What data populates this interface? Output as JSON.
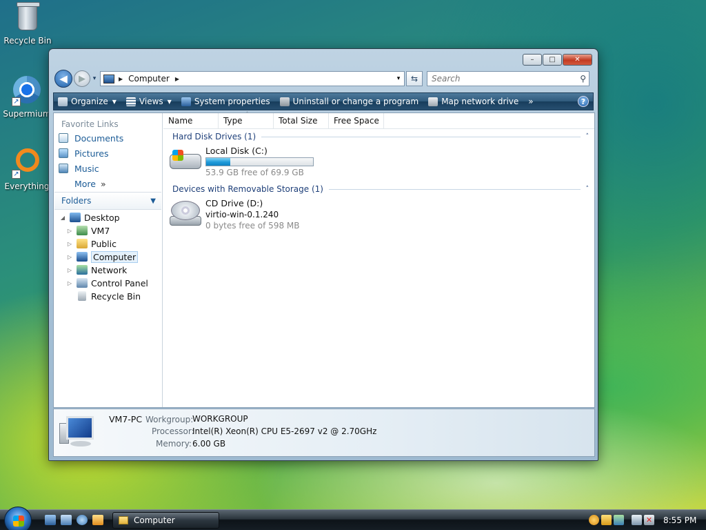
{
  "desktop": {
    "icons": [
      {
        "label": "Recycle Bin",
        "icon": "recycle-bin-icon"
      },
      {
        "label": "Supermium",
        "icon": "browser-icon"
      },
      {
        "label": "Everything",
        "icon": "everything-search-icon"
      }
    ]
  },
  "window": {
    "controls": {
      "minimize": "–",
      "maximize": "□",
      "close": "✕"
    },
    "nav": {
      "back": "◀",
      "forward": "▶",
      "history_dropdown": "▾"
    },
    "address": {
      "crumb_sep": "▶",
      "crumb": "Computer",
      "dropdown": "▾"
    },
    "refresh_label": "⇆",
    "search": {
      "placeholder": "Search",
      "icon": "search-icon"
    },
    "commands": [
      {
        "label": "Organize",
        "dropdown": true,
        "icon": "organize-icon"
      },
      {
        "label": "Views",
        "dropdown": true,
        "icon": "views-icon"
      },
      {
        "label": "System properties",
        "dropdown": false,
        "icon": "system-properties-icon"
      },
      {
        "label": "Uninstall or change a program",
        "dropdown": false,
        "icon": "uninstall-icon"
      },
      {
        "label": "Map network drive",
        "dropdown": false,
        "icon": "map-drive-icon"
      }
    ],
    "more_commands": "»",
    "help": "?"
  },
  "nav_pane": {
    "favorite_links_title": "Favorite Links",
    "favorites": [
      "Documents",
      "Pictures",
      "Music"
    ],
    "more_label": "More",
    "more_chevron": "»",
    "folders_title": "Folders",
    "folders_chevron": "⌵",
    "tree": [
      {
        "label": "Desktop",
        "expanded": true,
        "selected": false,
        "icon": "desktop-icon"
      },
      {
        "label": "VM7",
        "expanded": false,
        "selected": false,
        "icon": "user-folder-icon"
      },
      {
        "label": "Public",
        "expanded": false,
        "selected": false,
        "icon": "folder-icon"
      },
      {
        "label": "Computer",
        "expanded": false,
        "selected": true,
        "icon": "computer-icon"
      },
      {
        "label": "Network",
        "expanded": false,
        "selected": false,
        "icon": "network-icon"
      },
      {
        "label": "Control Panel",
        "expanded": false,
        "selected": false,
        "icon": "control-panel-icon"
      },
      {
        "label": "Recycle Bin",
        "expanded": null,
        "selected": false,
        "icon": "recycle-bin-icon"
      }
    ]
  },
  "columns": [
    "Name",
    "Type",
    "Total Size",
    "Free Space"
  ],
  "sort_indicator": "˄",
  "groups": [
    {
      "title": "Hard Disk Drives (1)",
      "collapse": "˄",
      "items": [
        {
          "name": "Local Disk (C:)",
          "free_text": "53.9 GB free of 69.9 GB",
          "used_fraction": 0.229,
          "icon": "hard-disk-icon"
        }
      ]
    },
    {
      "title": "Devices with Removable Storage (1)",
      "collapse": "˄",
      "items": [
        {
          "name": "CD Drive (D:)",
          "label": "virtio-win-0.1.240",
          "free_text": "0 bytes free of 598 MB",
          "icon": "cd-drive-icon"
        }
      ]
    }
  ],
  "details": {
    "computer_name": "VM7-PC",
    "workgroup_label": "Workgroup:",
    "workgroup": "WORKGROUP",
    "processor_label": "Processor:",
    "processor": "Intel(R) Xeon(R) CPU E5-2697 v2 @ 2.70GHz",
    "memory_label": "Memory:",
    "memory": "6.00 GB"
  },
  "taskbar": {
    "task_label": "Computer",
    "clock": "8:55 PM"
  }
}
